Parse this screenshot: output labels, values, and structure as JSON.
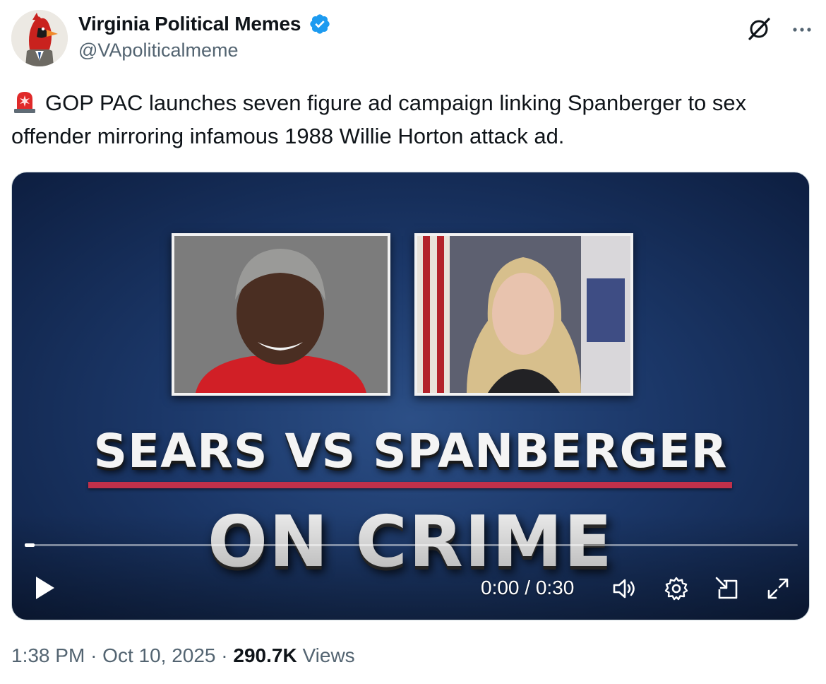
{
  "author": {
    "display_name": "Virginia Political Memes",
    "handle": "@VApoliticalmeme",
    "verified": true,
    "avatar_icon": "cardinal-avatar"
  },
  "actions": {
    "grok_icon": "grok-icon",
    "more_icon": "more-icon"
  },
  "tweet": {
    "emoji": "siren",
    "text": "GOP PAC launches seven figure ad campaign linking Spanberger to sex offender mirroring infamous 1988 Willie Horton attack ad."
  },
  "video": {
    "headline": "SEARS VS SPANBERGER",
    "subhead": "ON CRIME",
    "time_display": "0:00 / 0:30",
    "progress": 0,
    "controls": [
      "play-icon",
      "volume-icon",
      "settings-icon",
      "pip-icon",
      "fullscreen-icon"
    ]
  },
  "meta": {
    "time": "1:38 PM",
    "separator": "·",
    "date": "Oct 10, 2025",
    "views_count": "290.7K",
    "views_label": "Views"
  },
  "colors": {
    "verified_blue": "#1d9bf0",
    "rule_red": "#c0304a",
    "muted_text": "#536471"
  }
}
